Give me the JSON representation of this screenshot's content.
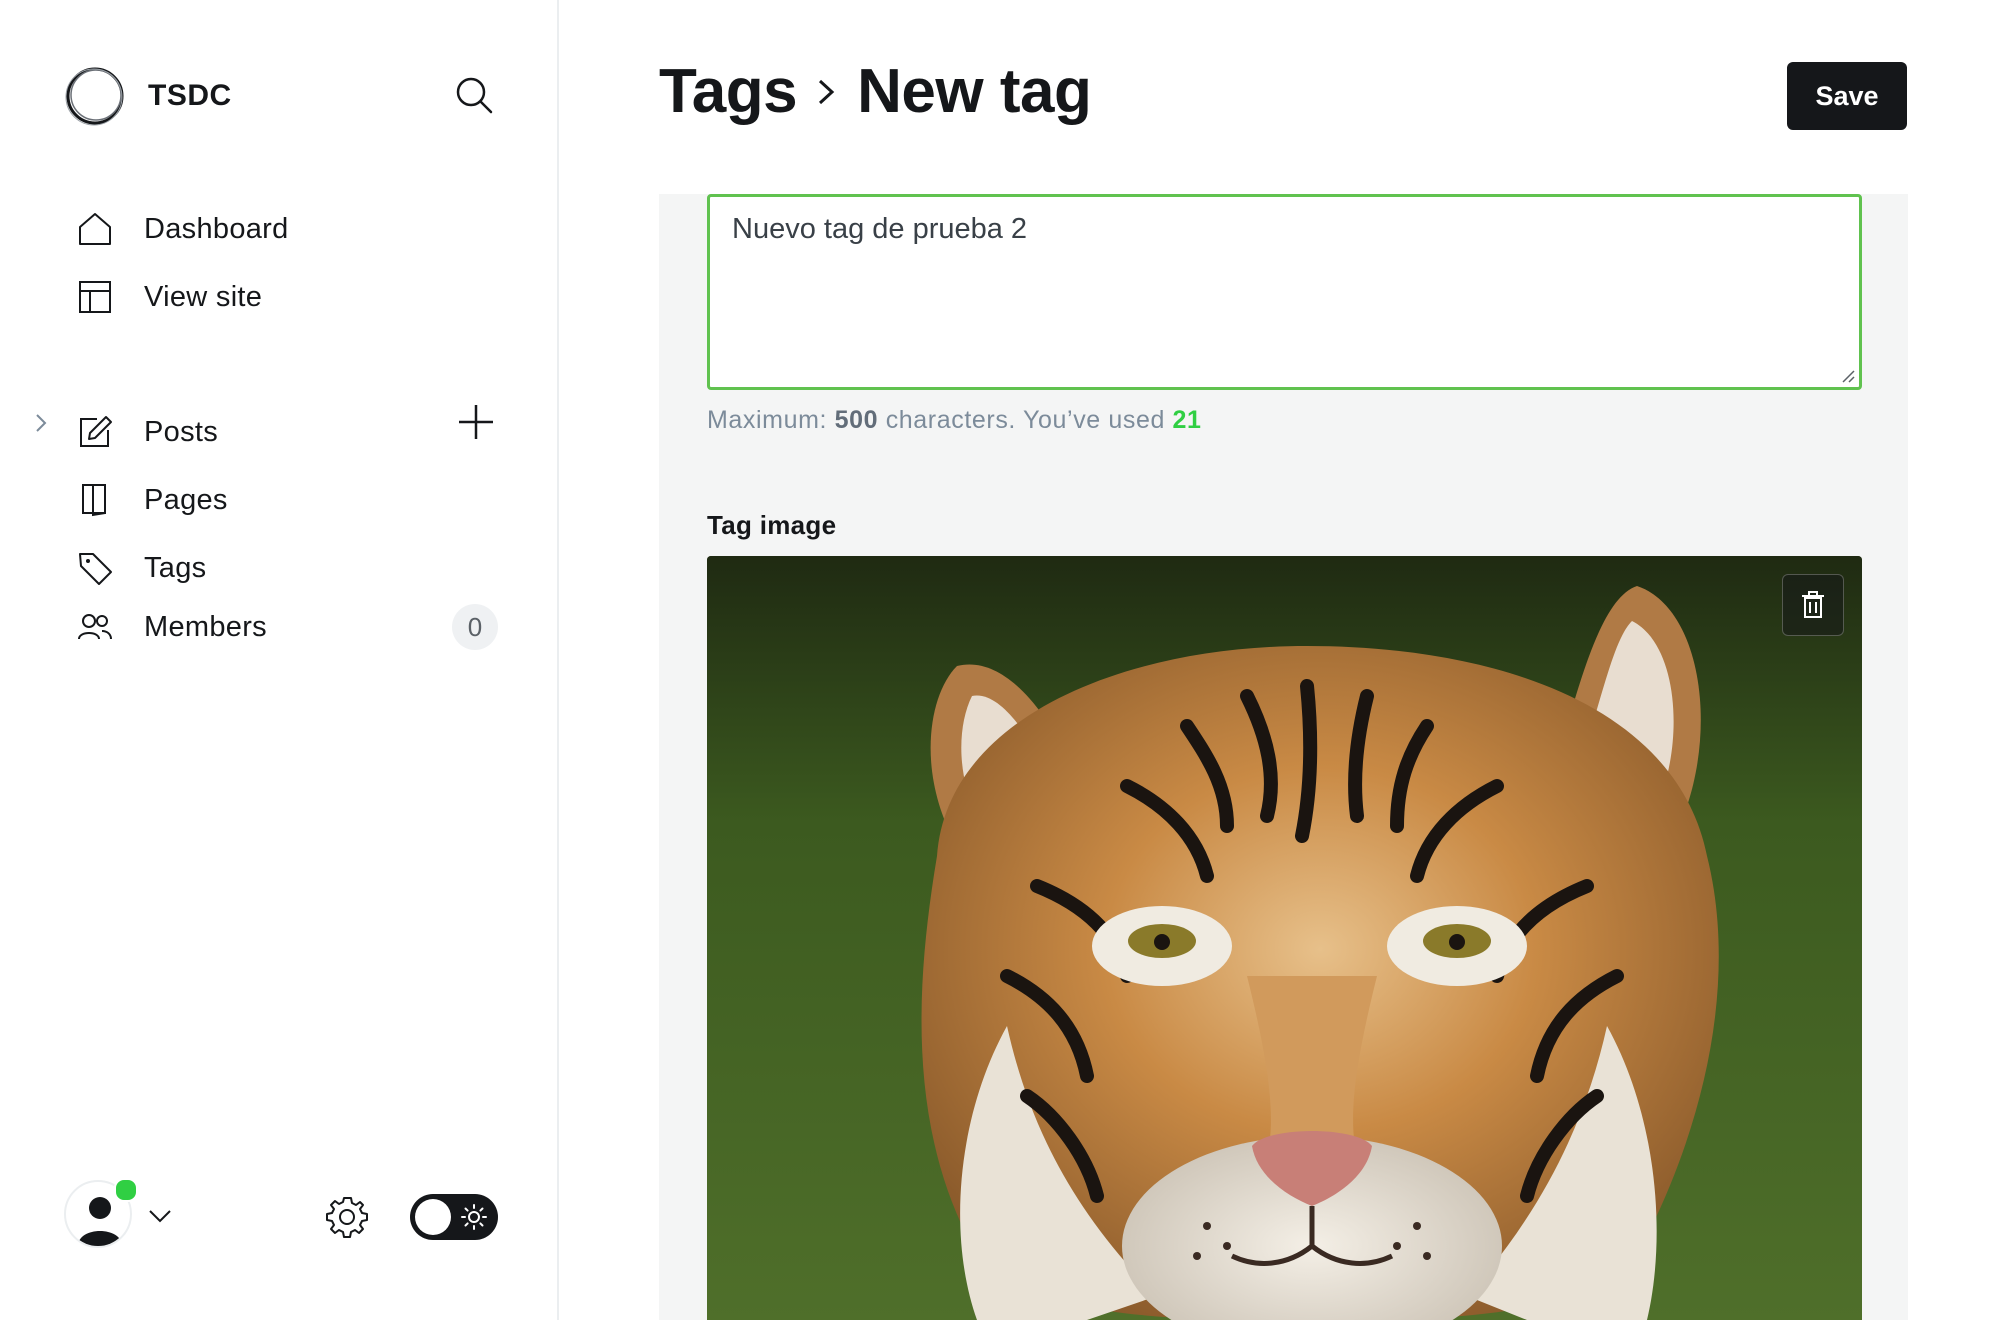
{
  "sidebar": {
    "brand_name": "TSDC",
    "nav_primary": [
      {
        "label": "Dashboard",
        "icon": "home-icon"
      },
      {
        "label": "View site",
        "icon": "layout-icon"
      }
    ],
    "nav_content": [
      {
        "label": "Posts",
        "icon": "edit-icon"
      },
      {
        "label": "Pages",
        "icon": "page-icon"
      },
      {
        "label": "Tags",
        "icon": "tag-icon"
      },
      {
        "label": "Members",
        "icon": "members-icon",
        "count": "0"
      }
    ]
  },
  "header": {
    "breadcrumb_parent": "Tags",
    "breadcrumb_current": "New tag",
    "save_label": "Save"
  },
  "form": {
    "description_value": "Nuevo tag de prueba 2",
    "hint_prefix": "Maximum: ",
    "hint_max": "500",
    "hint_middle": " characters. You’ve used ",
    "hint_used": "21",
    "image_label": "Tag image",
    "image_subject": "tiger"
  },
  "colors": {
    "accent_green": "#30cf43",
    "focus_border": "#60c24f",
    "primary_dark": "#15171a"
  }
}
